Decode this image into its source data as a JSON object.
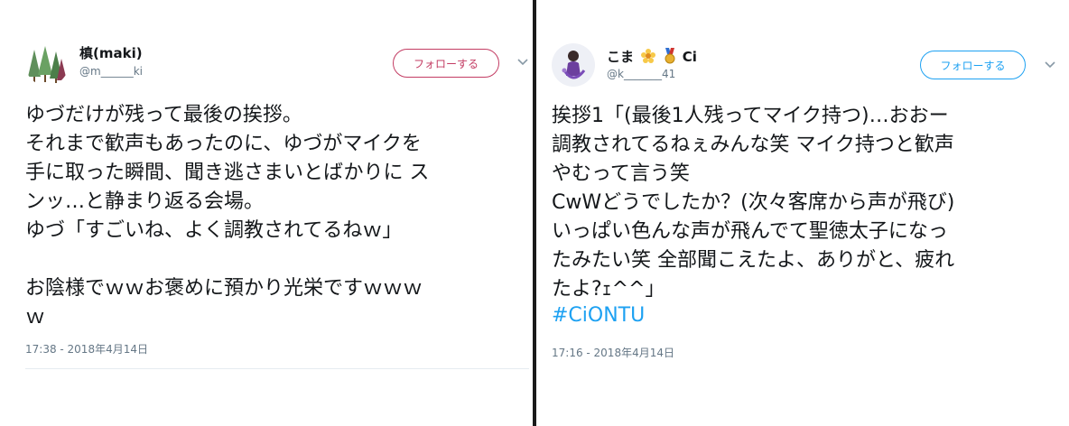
{
  "tweets": [
    {
      "name": "槙(maki)",
      "handle": "@m______ki",
      "follow_label": "フォローする",
      "body": "ゆづだけが残って最後の挨拶。\nそれまで歓声もあったのに、ゆづがマイクを\n手に取った瞬間、聞き逃さまいとばかりに ス\nンッ…と静まり返る会場。\nゆづ「すごいね、よく調教されてるねｗ」\n\nお陰様でｗｗお褒めに預かり光栄ですｗｗｗ\nｗ",
      "timestamp": "17:38 - 2018年4月14日",
      "accent_color": "#c33c63",
      "avatar_icon": "forest-avatar",
      "menu_icon": "chevron-down-icon"
    },
    {
      "name": "こま",
      "name_suffix": "Ci",
      "name_emoji": [
        "flower-icon",
        "medal-icon"
      ],
      "handle": "@k_______41",
      "follow_label": "フォローする",
      "body": "挨拶1「(最後1人残ってマイク持つ)…おおー\n調教されてるねぇみんな笑 マイク持つと歓声\nやむって言う笑\nCwWどうでしたか？(次々客席から声が飛び)\nいっぱい色んな声が飛んでて聖徳太子になっ\nたみたい笑 全部聞こえたよ、ありがと、疲れ\nたよ?ｪ^^」",
      "hashtag": "#CiONTU",
      "timestamp": "17:16 - 2018年4月14日",
      "accent_color": "#1da1f2",
      "avatar_icon": "skater-avatar",
      "menu_icon": "chevron-down-icon"
    }
  ]
}
